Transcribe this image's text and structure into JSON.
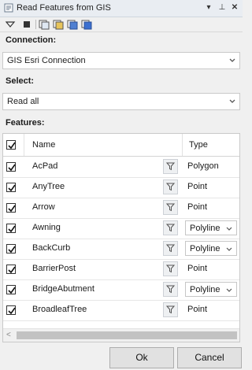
{
  "window": {
    "title": "Read Features from GIS",
    "icons": [
      "dropdown-arrow-icon",
      "pin-icon",
      "close-icon"
    ]
  },
  "toolbar": {
    "icons": [
      "filter-down-icon",
      "stop-icon",
      "layers-icon",
      "layers-blue-icon",
      "layers-check-icon",
      "layers-refresh-icon"
    ]
  },
  "connection": {
    "label": "Connection:",
    "value": "GIS Esri Connection"
  },
  "select": {
    "label": "Select:",
    "value": "Read all"
  },
  "features": {
    "label": "Features:",
    "columns": {
      "name": "Name",
      "type": "Type"
    },
    "rows": [
      {
        "name": "AcPad",
        "type": "Polygon",
        "dropdown": false
      },
      {
        "name": "AnyTree",
        "type": "Point",
        "dropdown": false
      },
      {
        "name": "Arrow",
        "type": "Point",
        "dropdown": false
      },
      {
        "name": "Awning",
        "type": "Polyline",
        "dropdown": true
      },
      {
        "name": "BackCurb",
        "type": "Polyline",
        "dropdown": true
      },
      {
        "name": "BarrierPost",
        "type": "Point",
        "dropdown": false
      },
      {
        "name": "BridgeAbutment",
        "type": "Polyline",
        "dropdown": true
      },
      {
        "name": "BroadleafTree",
        "type": "Point",
        "dropdown": false
      }
    ]
  },
  "buttons": {
    "ok": "Ok",
    "cancel": "Cancel"
  }
}
